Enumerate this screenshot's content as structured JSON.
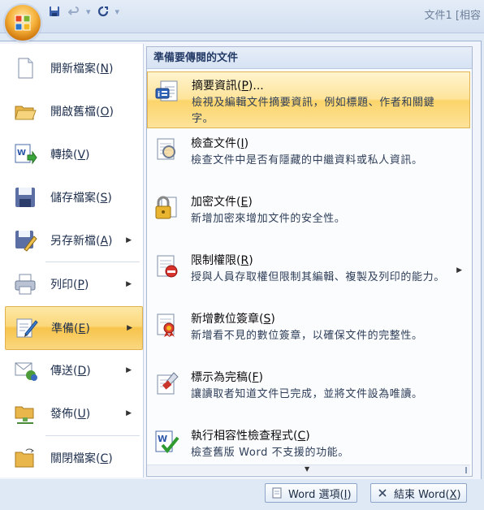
{
  "window": {
    "title": "文件1 [相容",
    "qat": {
      "save_icon": "save-icon",
      "undo_icon": "undo-icon",
      "redo_icon": "redo-icon",
      "customize_icon": "customize-qat-icon"
    }
  },
  "left_menu": {
    "items": [
      {
        "label": "開新檔案",
        "key": "N",
        "icon": "new-document-icon",
        "submenu": false
      },
      {
        "label": "開啟舊檔",
        "key": "O",
        "icon": "open-folder-icon",
        "submenu": false
      },
      {
        "label": "轉換",
        "key": "V",
        "icon": "convert-icon",
        "submenu": false
      },
      {
        "label": "儲存檔案",
        "key": "S",
        "icon": "save-disk-icon",
        "submenu": false
      },
      {
        "label": "另存新檔",
        "key": "A",
        "icon": "save-as-icon",
        "submenu": true
      },
      {
        "label": "列印",
        "key": "P",
        "icon": "printer-icon",
        "submenu": true
      },
      {
        "label": "準備",
        "key": "E",
        "icon": "prepare-icon",
        "submenu": true,
        "selected": true
      },
      {
        "label": "傳送",
        "key": "D",
        "icon": "send-icon",
        "submenu": true
      },
      {
        "label": "發佈",
        "key": "U",
        "icon": "publish-icon",
        "submenu": true
      },
      {
        "label": "關閉檔案",
        "key": "C",
        "icon": "close-file-icon",
        "submenu": false
      }
    ]
  },
  "prepare_panel": {
    "header": "準備要傳閱的文件",
    "items": [
      {
        "title": "摘要資訊",
        "key": "P",
        "suffix": "...",
        "desc": "檢視及編輯文件摘要資訊，例如標題、作者和關鍵字。",
        "icon": "properties-icon",
        "selected": true
      },
      {
        "title": "檢查文件",
        "key": "I",
        "suffix": "",
        "desc": "檢查文件中是否有隱藏的中繼資料或私人資訊。",
        "icon": "inspect-document-icon"
      },
      {
        "title": "加密文件",
        "key": "E",
        "suffix": "",
        "desc": "新增加密來增加文件的安全性。",
        "icon": "encrypt-lock-icon"
      },
      {
        "title": "限制權限",
        "key": "R",
        "suffix": "",
        "desc": "授與人員存取權但限制其編輯、複製及列印的能力。",
        "icon": "restrict-permission-icon",
        "submenu": true
      },
      {
        "title": "新增數位簽章",
        "key": "S",
        "suffix": "",
        "desc": "新增看不見的數位簽章，以確保文件的完整性。",
        "icon": "digital-signature-icon"
      },
      {
        "title": "標示為完稿",
        "key": "F",
        "suffix": "",
        "desc": "讓讀取者知道文件已完成，並將文件設為唯讀。",
        "icon": "mark-final-icon"
      },
      {
        "title": "執行相容性檢查程式",
        "key": "C",
        "suffix": "",
        "desc": "檢查舊版 Word 不支援的功能。",
        "icon": "compatibility-checker-icon"
      }
    ]
  },
  "bottom": {
    "options_label": "Word 選項",
    "options_key": "I",
    "exit_label": "結束 Word",
    "exit_key": "X"
  }
}
